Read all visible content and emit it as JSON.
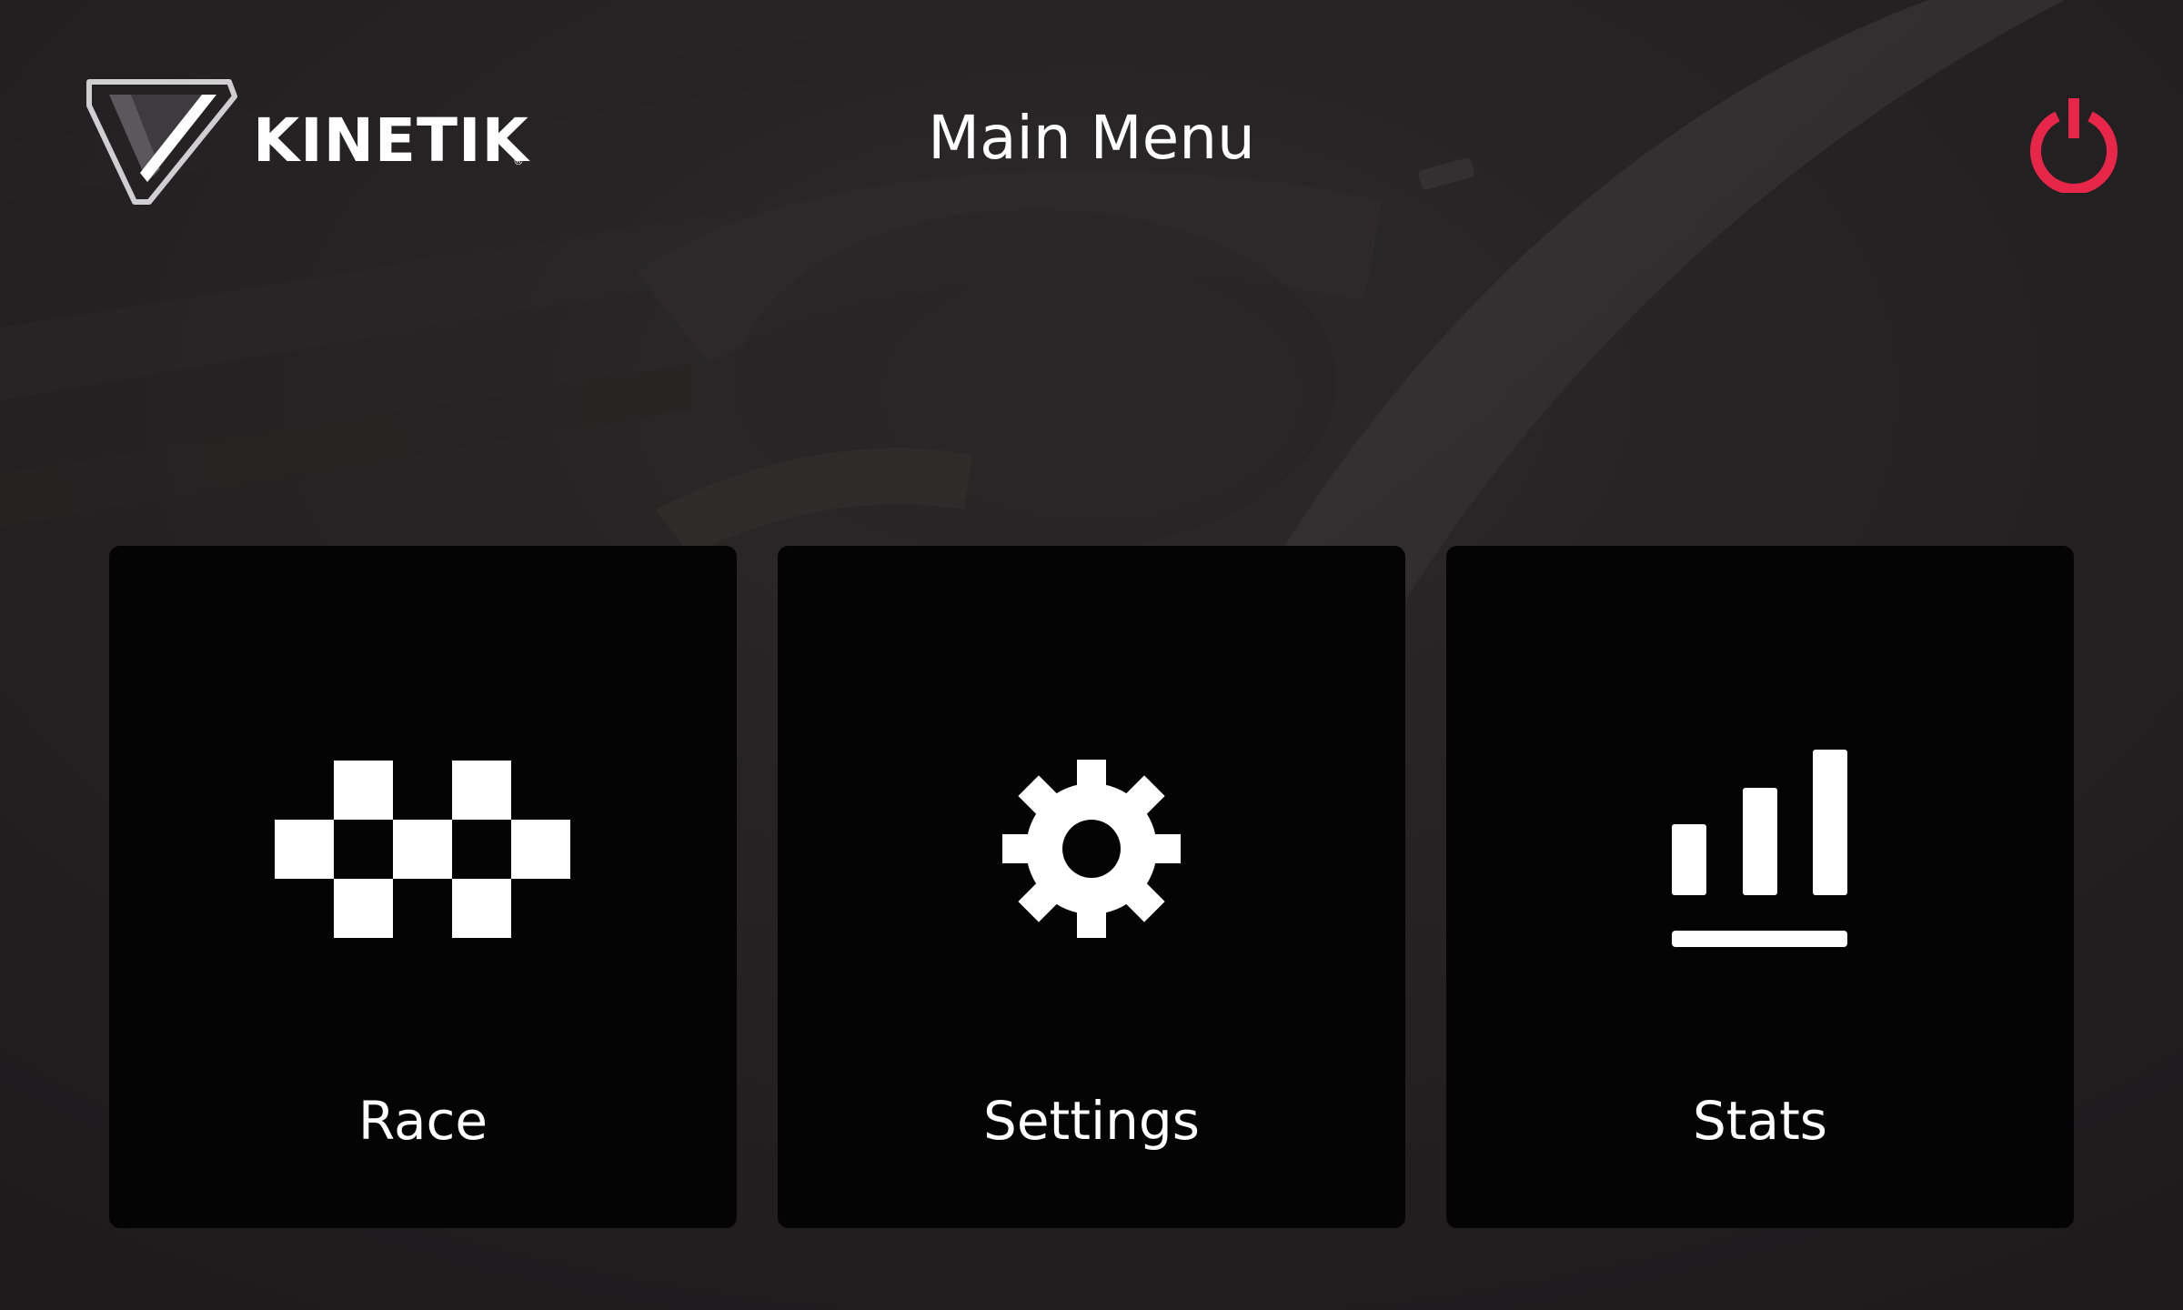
{
  "app": {
    "brand_name": "KINETIK",
    "brand_registered_mark": "®"
  },
  "header": {
    "title": "Main Menu",
    "power_icon": "power-icon"
  },
  "menu": {
    "tiles": [
      {
        "label": "Race",
        "icon": "checkered-flag-icon"
      },
      {
        "label": "Settings",
        "icon": "gear-icon"
      },
      {
        "label": "Stats",
        "icon": "bar-chart-icon"
      }
    ]
  },
  "colors": {
    "background": "#221f20",
    "tile": "#040405",
    "text": "#ffffff",
    "power_accent": "#e8264a"
  }
}
